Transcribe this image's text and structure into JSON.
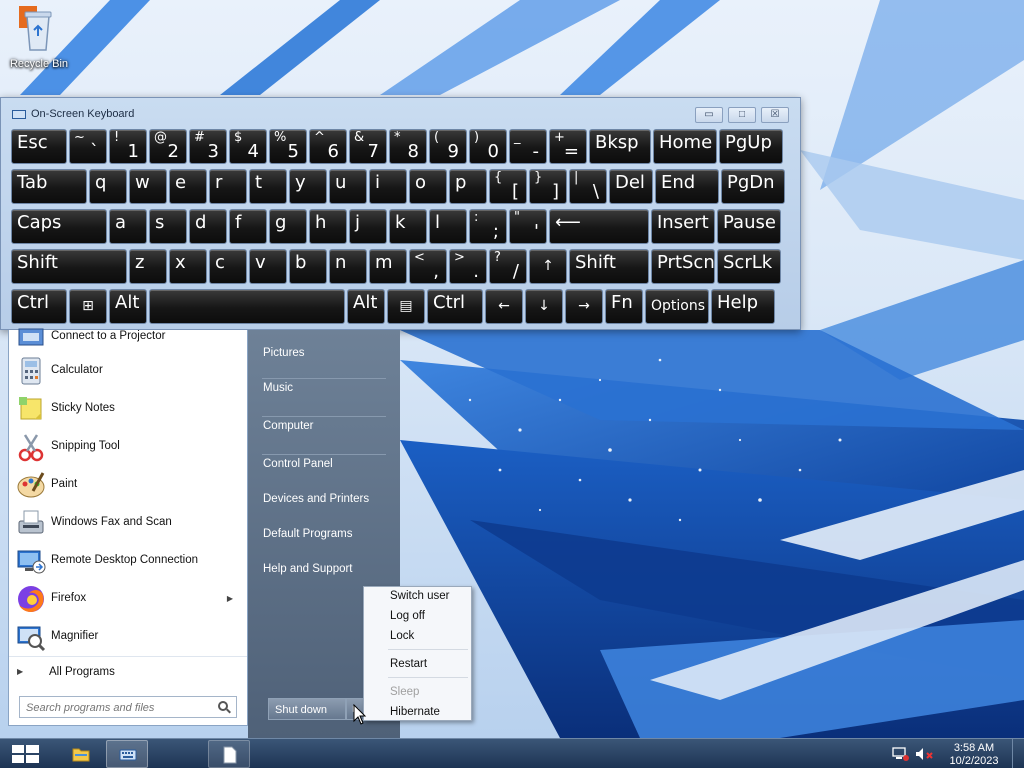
{
  "desktop": {
    "icons": [
      {
        "label": "Recycle Bin",
        "icon": "recycle-bin-icon"
      }
    ]
  },
  "osk": {
    "title": "On-Screen Keyboard",
    "buttons": {
      "minimize": "▭",
      "maximize": "□",
      "close": "☒"
    },
    "rows": [
      [
        {
          "t": "Esc"
        },
        {
          "s": "~",
          "m": "`"
        },
        {
          "s": "!",
          "m": "1"
        },
        {
          "s": "@",
          "m": "2"
        },
        {
          "s": "#",
          "m": "3"
        },
        {
          "s": "$",
          "m": "4"
        },
        {
          "s": "%",
          "m": "5"
        },
        {
          "s": "^",
          "m": "6"
        },
        {
          "s": "&",
          "m": "7"
        },
        {
          "s": "*",
          "m": "8"
        },
        {
          "s": "(",
          "m": "9"
        },
        {
          "s": ")",
          "m": "0"
        },
        {
          "s": "_",
          "m": "-"
        },
        {
          "s": "+",
          "m": "="
        },
        {
          "t": "Bksp"
        },
        {
          "t": "Home"
        },
        {
          "t": "PgUp"
        }
      ],
      [
        {
          "t": "Tab"
        },
        {
          "t": "q"
        },
        {
          "t": "w"
        },
        {
          "t": "e"
        },
        {
          "t": "r"
        },
        {
          "t": "t"
        },
        {
          "t": "y"
        },
        {
          "t": "u"
        },
        {
          "t": "i"
        },
        {
          "t": "o"
        },
        {
          "t": "p"
        },
        {
          "s": "{",
          "m": "["
        },
        {
          "s": "}",
          "m": "]"
        },
        {
          "s": "|",
          "m": "\\"
        },
        {
          "t": "Del"
        },
        {
          "t": "End"
        },
        {
          "t": "PgDn"
        }
      ],
      [
        {
          "t": "Caps"
        },
        {
          "t": "a"
        },
        {
          "t": "s"
        },
        {
          "t": "d"
        },
        {
          "t": "f"
        },
        {
          "t": "g"
        },
        {
          "t": "h"
        },
        {
          "t": "j"
        },
        {
          "t": "k"
        },
        {
          "t": "l"
        },
        {
          "s": ":",
          "m": ";"
        },
        {
          "s": "\"",
          "m": "'"
        },
        {
          "t": "⟵"
        },
        {
          "t": "Insert"
        },
        {
          "t": "Pause"
        }
      ],
      [
        {
          "t": "Shift"
        },
        {
          "t": "z"
        },
        {
          "t": "x"
        },
        {
          "t": "c"
        },
        {
          "t": "v"
        },
        {
          "t": "b"
        },
        {
          "t": "n"
        },
        {
          "t": "m"
        },
        {
          "s": "<",
          "m": ","
        },
        {
          "s": ">",
          "m": "."
        },
        {
          "s": "?",
          "m": "/"
        },
        {
          "t": "↑"
        },
        {
          "t": "Shift"
        },
        {
          "t": "PrtScn"
        },
        {
          "t": "ScrLk"
        }
      ],
      [
        {
          "t": "Ctrl"
        },
        {
          "t": "⊞"
        },
        {
          "t": "Alt"
        },
        {
          "t": ""
        },
        {
          "t": "Alt"
        },
        {
          "t": "▤"
        },
        {
          "t": "Ctrl"
        },
        {
          "t": "←"
        },
        {
          "t": "↓"
        },
        {
          "t": "→"
        },
        {
          "t": "Fn"
        },
        {
          "t": "Options"
        },
        {
          "t": "Help"
        }
      ]
    ]
  },
  "start_menu": {
    "programs": [
      {
        "label": "Connect to a Projector",
        "icon": "projector-icon"
      },
      {
        "label": "Calculator",
        "icon": "calculator-icon"
      },
      {
        "label": "Sticky Notes",
        "icon": "sticky-notes-icon"
      },
      {
        "label": "Snipping Tool",
        "icon": "snipping-tool-icon"
      },
      {
        "label": "Paint",
        "icon": "paint-icon"
      },
      {
        "label": "Windows Fax and Scan",
        "icon": "fax-scan-icon"
      },
      {
        "label": "Remote Desktop Connection",
        "icon": "remote-desktop-icon"
      },
      {
        "label": "Firefox",
        "icon": "firefox-icon",
        "submenu": true
      },
      {
        "label": "Magnifier",
        "icon": "magnifier-icon"
      }
    ],
    "all_programs": "All Programs",
    "search_placeholder": "Search programs and files",
    "right_items": [
      "Pictures",
      "Music",
      "Computer",
      "Control Panel",
      "Devices and Printers",
      "Default Programs",
      "Help and Support"
    ],
    "shutdown_label": "Shut down"
  },
  "power_menu": {
    "items": [
      {
        "label": "Switch user",
        "enabled": true
      },
      {
        "label": "Log off",
        "enabled": true
      },
      {
        "label": "Lock",
        "enabled": true
      },
      {
        "label": "Restart",
        "enabled": true
      },
      {
        "label": "Sleep",
        "enabled": false
      },
      {
        "label": "Hibernate",
        "enabled": true
      }
    ]
  },
  "taskbar": {
    "clock_time": "3:58 AM",
    "clock_date": "10/2/2023"
  }
}
